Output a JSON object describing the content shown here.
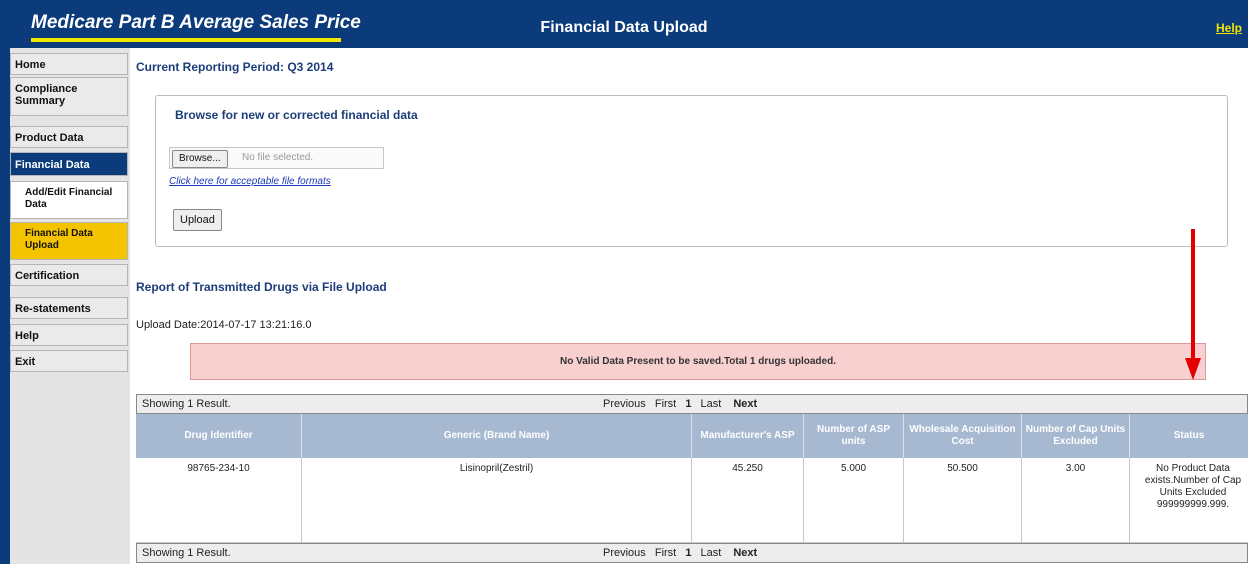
{
  "header": {
    "brand": "Medicare Part B Average Sales Price",
    "title": "Financial Data Upload",
    "help": "Help"
  },
  "sidebar": {
    "items": [
      {
        "label": "Home"
      },
      {
        "label": "Compliance Summary"
      },
      {
        "label": "Product Data"
      },
      {
        "label": "Financial Data"
      },
      {
        "label": "Add/Edit Financial Data"
      },
      {
        "label": "Financial Data Upload"
      },
      {
        "label": "Certification"
      },
      {
        "label": "Re-statements"
      },
      {
        "label": "Help"
      },
      {
        "label": "Exit"
      }
    ]
  },
  "main": {
    "period": "Current Reporting Period: Q3 2014",
    "upload_panel": {
      "title": "Browse for new or corrected financial data",
      "browse_label": "Browse...",
      "file_status": "No file selected.",
      "formats_link": "Click here for acceptable file formats",
      "upload_label": "Upload"
    },
    "report_title": "Report of Transmitted Drugs via File Upload",
    "upload_date": "Upload Date:2014-07-17 13:21:16.0",
    "alert": "No Valid Data Present to be saved.Total 1 drugs uploaded.",
    "results": {
      "count": "Showing 1 Result.",
      "pager": {
        "previous": "Previous",
        "first": "First",
        "current": "1",
        "last": "Last",
        "next": "Next"
      }
    },
    "table": {
      "columns": [
        "Drug Identifier",
        "Generic (Brand Name)",
        "Manufacturer's ASP",
        "Number of ASP units",
        "Wholesale Acquisition Cost",
        "Number of Cap Units Excluded",
        "Status"
      ],
      "rows": [
        [
          "98765-234-10",
          "Lisinopril(Zestril)",
          "45.250",
          "5.000",
          "50.500",
          "3.00",
          "No Product Data exists.Number of Cap Units Excluded 999999999.999."
        ]
      ]
    }
  },
  "colors": {
    "header_bg": "#0b3b7a",
    "brand_accent": "#f3e600",
    "active_nav": "#0b3b7a",
    "current_subnav": "#f5c400",
    "alert_bg": "#f8d0d0",
    "table_header": "#a6b9d0",
    "annotation_arrow": "#e40000"
  },
  "icons": [
    "arrow-down-icon"
  ]
}
